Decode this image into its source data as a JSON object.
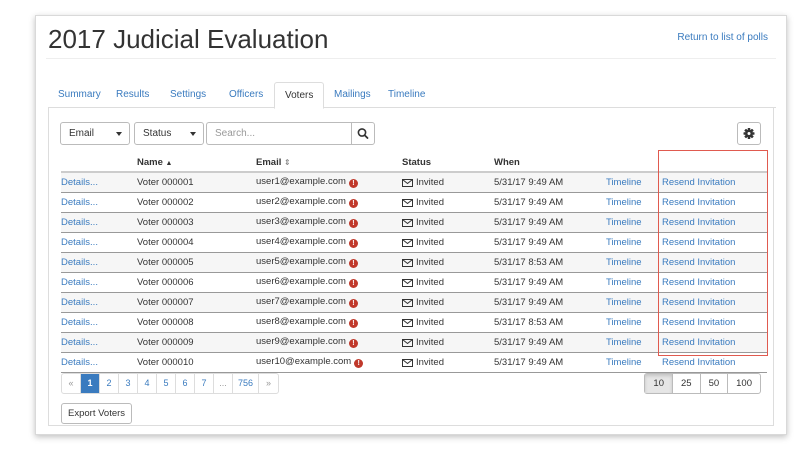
{
  "page": {
    "title": "2017 Judicial Evaluation",
    "return_link": "Return to list of polls"
  },
  "tabs": [
    {
      "label": "Summary"
    },
    {
      "label": "Results"
    },
    {
      "label": "Settings"
    },
    {
      "label": "Officers"
    },
    {
      "label": "Voters",
      "active": true
    },
    {
      "label": "Mailings"
    },
    {
      "label": "Timeline"
    }
  ],
  "filters": {
    "field_select": "Email",
    "status_select": "Status",
    "search_placeholder": "Search...",
    "search_icon": "magnifier-icon",
    "settings_icon": "gear-icon"
  },
  "table": {
    "columns": {
      "name": "Name",
      "name_sort": "▲",
      "email": "Email",
      "email_sort": "⇕",
      "status": "Status",
      "when": "When"
    },
    "rows": [
      {
        "details": "Details...",
        "name": "Voter 000001",
        "email": "user1@example.com",
        "status": "Invited",
        "when": "5/31/17 9:49 AM",
        "timeline": "Timeline",
        "action": "Resend Invitation"
      },
      {
        "details": "Details...",
        "name": "Voter 000002",
        "email": "user2@example.com",
        "status": "Invited",
        "when": "5/31/17 9:49 AM",
        "timeline": "Timeline",
        "action": "Resend Invitation"
      },
      {
        "details": "Details...",
        "name": "Voter 000003",
        "email": "user3@example.com",
        "status": "Invited",
        "when": "5/31/17 9:49 AM",
        "timeline": "Timeline",
        "action": "Resend Invitation"
      },
      {
        "details": "Details...",
        "name": "Voter 000004",
        "email": "user4@example.com",
        "status": "Invited",
        "when": "5/31/17 9:49 AM",
        "timeline": "Timeline",
        "action": "Resend Invitation"
      },
      {
        "details": "Details...",
        "name": "Voter 000005",
        "email": "user5@example.com",
        "status": "Invited",
        "when": "5/31/17 8:53 AM",
        "timeline": "Timeline",
        "action": "Resend Invitation"
      },
      {
        "details": "Details...",
        "name": "Voter 000006",
        "email": "user6@example.com",
        "status": "Invited",
        "when": "5/31/17 9:49 AM",
        "timeline": "Timeline",
        "action": "Resend Invitation"
      },
      {
        "details": "Details...",
        "name": "Voter 000007",
        "email": "user7@example.com",
        "status": "Invited",
        "when": "5/31/17 9:49 AM",
        "timeline": "Timeline",
        "action": "Resend Invitation"
      },
      {
        "details": "Details...",
        "name": "Voter 000008",
        "email": "user8@example.com",
        "status": "Invited",
        "when": "5/31/17 8:53 AM",
        "timeline": "Timeline",
        "action": "Resend Invitation"
      },
      {
        "details": "Details...",
        "name": "Voter 000009",
        "email": "user9@example.com",
        "status": "Invited",
        "when": "5/31/17 9:49 AM",
        "timeline": "Timeline",
        "action": "Resend Invitation"
      },
      {
        "details": "Details...",
        "name": "Voter 000010",
        "email": "user10@example.com",
        "status": "Invited",
        "when": "5/31/17 9:49 AM",
        "timeline": "Timeline",
        "action": "Resend Invitation"
      }
    ],
    "warning_glyph": "!"
  },
  "pagination": {
    "prev": "«",
    "pages": [
      "1",
      "2",
      "3",
      "4",
      "5",
      "6",
      "7",
      "...",
      "756"
    ],
    "active_page": "1",
    "next": "»"
  },
  "page_size": {
    "options": [
      "10",
      "25",
      "50",
      "100"
    ],
    "active": "10"
  },
  "export_label": "Export Voters",
  "colors": {
    "link": "#3a7bbf",
    "warning": "#c0392b",
    "highlight": "#e05a4f"
  }
}
